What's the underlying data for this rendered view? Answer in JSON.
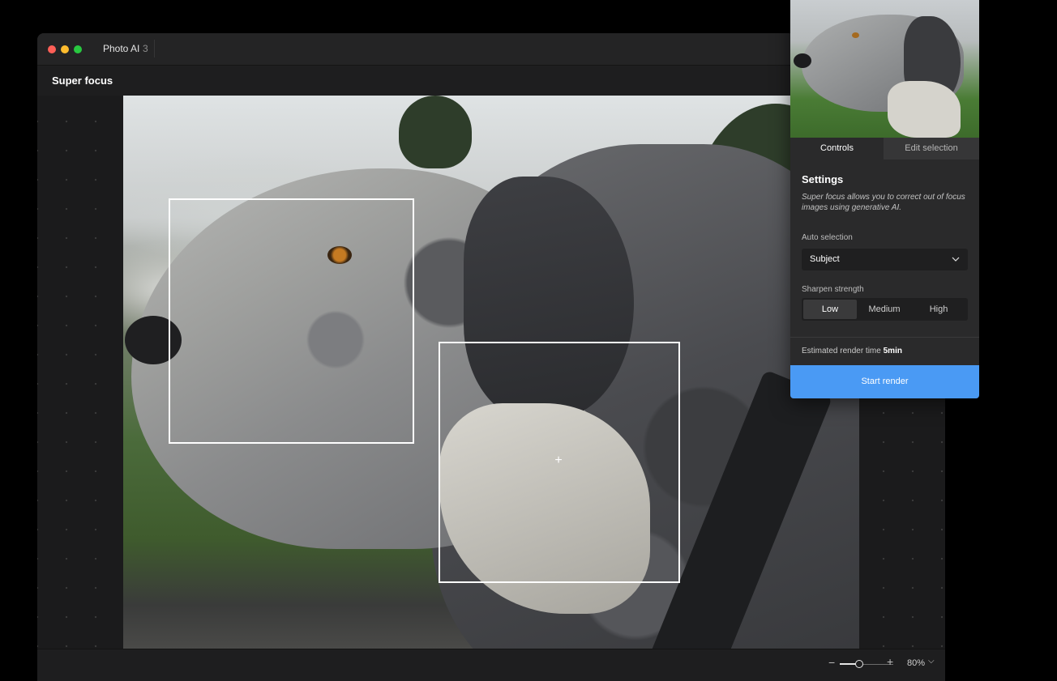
{
  "window": {
    "app_name": "Photo AI",
    "app_version": "3",
    "traffic_lights": {
      "close": "#fe5f57",
      "minimize": "#febc2e",
      "maximize": "#28c840"
    }
  },
  "tool": {
    "title": "Super focus"
  },
  "canvas": {
    "crosshair_glyph": "+",
    "selections": [
      "selection-box",
      "selection-box"
    ]
  },
  "zoom": {
    "minus": "−",
    "plus": "+",
    "value": "80%",
    "level": 0.8,
    "chevron": "⌵"
  },
  "panel": {
    "tabs": [
      {
        "label": "Controls",
        "active": true
      },
      {
        "label": "Edit selection",
        "active": false
      }
    ],
    "settings": {
      "title": "Settings",
      "description": "Super focus allows you to correct out of focus images using generative AI."
    },
    "auto_selection": {
      "label": "Auto selection",
      "value": "Subject"
    },
    "sharpen_strength": {
      "label": "Sharpen strength",
      "options": [
        "Low",
        "Medium",
        "High"
      ],
      "selected": "Low"
    },
    "render": {
      "estimate_label": "Estimated render time",
      "estimate_value": "5min",
      "button_label": "Start render"
    },
    "accent_color": "#4a9af4"
  }
}
